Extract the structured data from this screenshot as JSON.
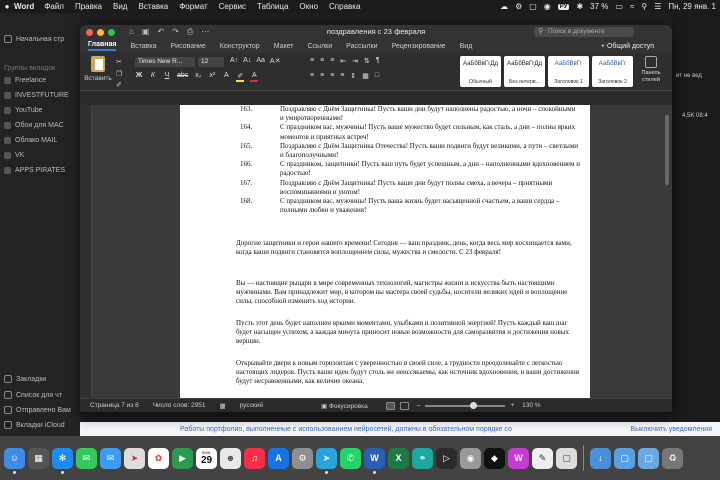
{
  "menubar": {
    "app": "Word",
    "items": [
      "Файл",
      "Правка",
      "Вид",
      "Вставка",
      "Формат",
      "Сервис",
      "Таблица",
      "Окно",
      "Справка"
    ],
    "input_lang": "РУ",
    "battery": "37 %",
    "datetime": "Пн, 29 янв. 1"
  },
  "bg_sidebar": {
    "start": "Начальная стр",
    "group_label": "Группы вкладок",
    "groups": [
      "Freelance",
      "INVESTFUTURE",
      "YouTube",
      "Обои для MAC",
      "Облако MAIL",
      "VK",
      "APPS PIRATES"
    ],
    "bottom": [
      "Закладки",
      "Список для чт",
      "Отправлено Вам",
      "Вкладки iCloud"
    ]
  },
  "bg_right": {
    "line1": "ит не вед",
    "line2": "4,5K 08:4"
  },
  "bg_bottom": {
    "text": "Работы портфолио, выполненные с использованием нейросетей, должны в обязательном порядке со",
    "notif": "Выключить уведомления"
  },
  "word": {
    "title": "поздравления с 23 февраля",
    "search_placeholder": "Поиск в документе",
    "tabs": [
      "Главная",
      "Вставка",
      "Рисование",
      "Конструктор",
      "Макет",
      "Ссылки",
      "Рассылки",
      "Рецензирование",
      "Вид"
    ],
    "share": "Общий доступ",
    "ribbon": {
      "paste": "Вставить",
      "font_name": "Times New R...",
      "font_size": "12",
      "styles": [
        {
          "sample": "АаБбВвГгДд",
          "label": "Обычный"
        },
        {
          "sample": "АаБбВвГгДд",
          "label": "Без интерв..."
        },
        {
          "sample": "АаБбВвГг",
          "label": "Заголовок 1"
        },
        {
          "sample": "АаБбВвГг",
          "label": "Заголовок 2"
        }
      ],
      "styles_pane": "Панель стилей"
    },
    "list": [
      {
        "n": "163.",
        "t": "Поздравляю с Днём Защитника! Пусть ваши дни будут наполнены радостью, а ночи – спокойными и умиротворенными!"
      },
      {
        "n": "164.",
        "t": "С праздником вас, мужчины! Пусть ваше мужество будет сильным, как сталь, а дни – полны ярких моментов и приятных встреч!"
      },
      {
        "n": "165.",
        "t": "Поздравляю с Днём Защитника Отечества! Пусть ваши подвиги будут великими, а пути – светлыми и благополучными!"
      },
      {
        "n": "166.",
        "t": "С праздником, защитники! Пусть ваш путь будет успешным, а дни – наполненными вдохновением и радостью!"
      },
      {
        "n": "167.",
        "t": "Поздравляю с Днём Защитника! Пусть ваши дни будут полны смеха, а вечера – приятными воспоминаниями и уютом!"
      },
      {
        "n": "168.",
        "t": "С праздником вас, мужчины! Пусть ваша жизнь будет насыщенной счастьем, а ваши сердца – полными любви и уважения!"
      }
    ],
    "paragraphs": [
      "Дорогие защитники и герои нашего времени! Сегодня — ваш праздник, день, когда весь мир восхищается вами, когда ваши подвиги становятся воплощением силы, мужества и смелости. С 23 февраля!",
      "Вы — настоящие рыцари в мире современных технологий, магистры жизни и искусства быть настоящими мужчинами. Вам принадлежит мир, в котором вы мастера своей судьбы, носители великих идей и воплощение силы, способной изменить ход истории.",
      "Пусть этот день будет наполнен яркими моментами, улыбками и позитивной энергией! Пусть каждый ваш шаг будет насыщен успехом, а каждая минута приносит новые возможности для саморазвития и достижения новых вершин.",
      "Открывайте двери к новым горизонтам с уверенностью в своей силе, а трудности преодолевайте с легкостью настоящих лидеров. Пусть ваши идеи будут столь же неиссякаемы, как источник вдохновения, и ваши достижения будут несравненными, как величие океана."
    ],
    "status": {
      "page": "Страница 7 из 8",
      "words": "Число слов: 2951",
      "lang": "русский",
      "focus": "Фокусировка",
      "zoom": "130 %",
      "zoom_fraction": 0.6
    }
  },
  "dock": {
    "calendar_month": "ЯНВ.",
    "calendar_day": "29"
  },
  "colors": {
    "accent": "#3a7be0",
    "close": "#ff5f57",
    "minimize": "#febc2e",
    "maximize": "#28c840"
  }
}
